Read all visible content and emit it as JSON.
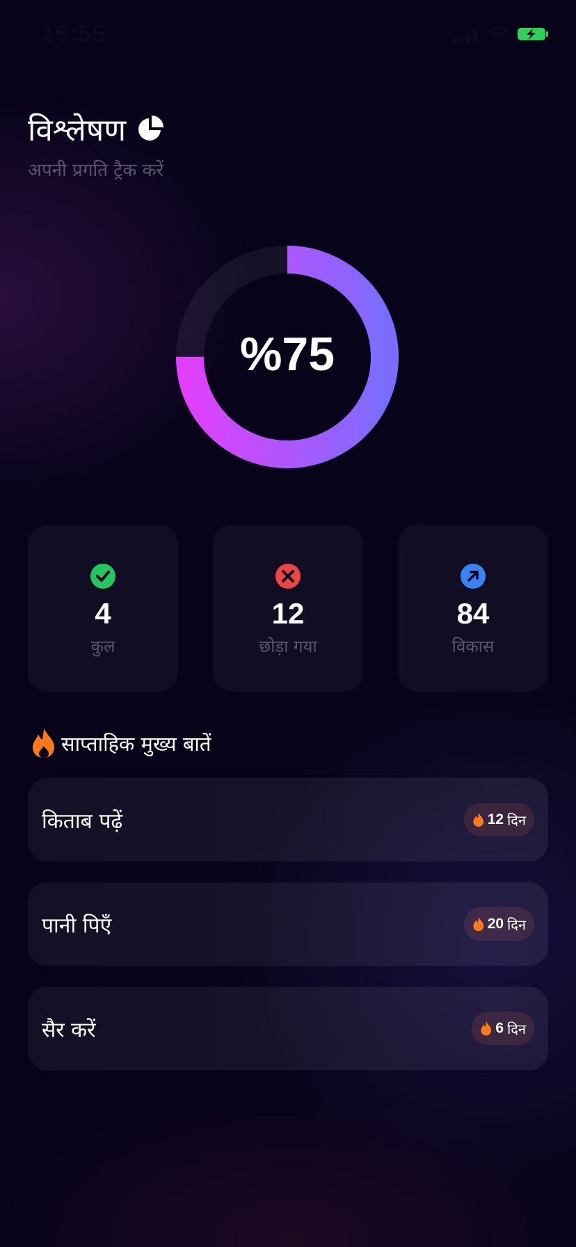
{
  "status_bar": {
    "time": "16:55"
  },
  "header": {
    "title": "विश्लेषण",
    "subtitle": "अपनी प्रगति ट्रैक करें"
  },
  "progress": {
    "label": "%75",
    "value": 0.75
  },
  "stats": [
    {
      "value": "4",
      "label": "कुल",
      "icon": "check-circle-icon",
      "color": "#22c55e"
    },
    {
      "value": "12",
      "label": "छोड़ा गया",
      "icon": "x-circle-icon",
      "color": "#ef4444"
    },
    {
      "value": "84",
      "label": "विकास",
      "icon": "arrow-up-right-icon",
      "color": "#3b82f6"
    }
  ],
  "weekly": {
    "title": "साप्ताहिक मुख्य बातें",
    "items": [
      {
        "name": "किताब पढ़ें",
        "days": "12",
        "unit": "दिन"
      },
      {
        "name": "पानी पिएँ",
        "days": "20",
        "unit": "दिन"
      },
      {
        "name": "सैर करें",
        "days": "6",
        "unit": "दिन"
      }
    ]
  },
  "colors": {
    "accent_pink": "#e040fb",
    "accent_blue": "#6b7cff",
    "flame": "#ff7a1a"
  }
}
